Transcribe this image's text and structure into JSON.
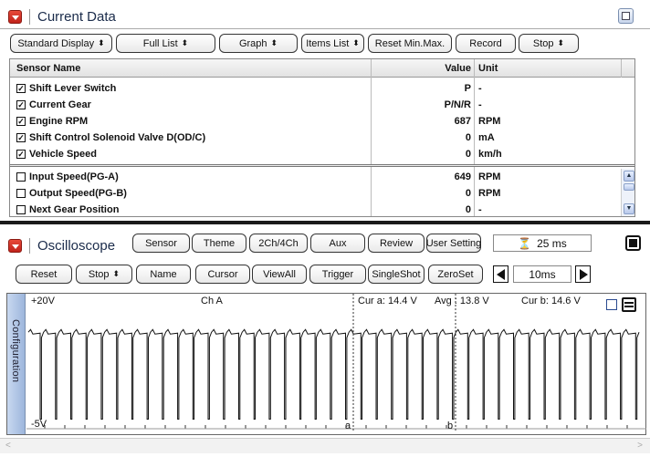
{
  "current_data": {
    "title": "Current Data",
    "toolbar": [
      {
        "label": "Standard Display",
        "arrows": true
      },
      {
        "label": "Full List",
        "arrows": true
      },
      {
        "label": "Graph",
        "arrows": true
      },
      {
        "label": "Items List",
        "arrows": true
      },
      {
        "label": "Reset Min.Max.",
        "arrows": false
      },
      {
        "label": "Record",
        "arrows": false
      },
      {
        "label": "Stop",
        "arrows": true
      }
    ],
    "columns": {
      "name": "Sensor Name",
      "value": "Value",
      "unit": "Unit"
    },
    "rows": [
      {
        "checked": true,
        "name": "Shift Lever Switch",
        "value": "P",
        "unit": "-"
      },
      {
        "checked": true,
        "name": "Current Gear",
        "value": "P/N/R",
        "unit": "-"
      },
      {
        "checked": true,
        "name": "Engine RPM",
        "value": "687",
        "unit": "RPM"
      },
      {
        "checked": true,
        "name": "Shift Control Solenoid Valve D(OD/C)",
        "value": "0",
        "unit": "mA"
      },
      {
        "checked": true,
        "name": "Vehicle Speed",
        "value": "0",
        "unit": "km/h"
      },
      {
        "checked": false,
        "name": "Input Speed(PG-A)",
        "value": "649",
        "unit": "RPM"
      },
      {
        "checked": false,
        "name": "Output Speed(PG-B)",
        "value": "0",
        "unit": "RPM"
      },
      {
        "checked": false,
        "name": "Next Gear Position",
        "value": "0",
        "unit": "-"
      }
    ]
  },
  "oscilloscope": {
    "title": "Oscilloscope",
    "top_buttons": [
      "Sensor",
      "Theme",
      "2Ch/4Ch",
      "Aux",
      "Review",
      "User Setting"
    ],
    "timebase_display": "25 ms",
    "bottom_buttons": [
      {
        "label": "Reset",
        "arrows": false
      },
      {
        "label": "Stop",
        "arrows": true
      },
      {
        "label": "Name",
        "arrows": false
      },
      {
        "label": "Cursor",
        "arrows": false
      },
      {
        "label": "ViewAll",
        "arrows": false
      },
      {
        "label": "Trigger",
        "arrows": false
      },
      {
        "label": "SingleShot",
        "arrows": false
      },
      {
        "label": "ZeroSet",
        "arrows": false
      }
    ],
    "time_div": "10ms",
    "config_tab": "Configuration",
    "labels": {
      "ymax": "+20V",
      "ymin": "-5V",
      "channel": "Ch A",
      "cur_a": "Cur a: 14.4 V",
      "avg": "Avg : 13.8 V",
      "cur_b": "Cur b: 14.6 V",
      "cursor_a": "a",
      "cursor_b": "b"
    },
    "waveform": {
      "high_v": 14.4,
      "low_v": -4.5,
      "pulses": 40
    }
  },
  "colors": {
    "accent_red": "#d3281c",
    "grid": "#dcdcdc"
  }
}
